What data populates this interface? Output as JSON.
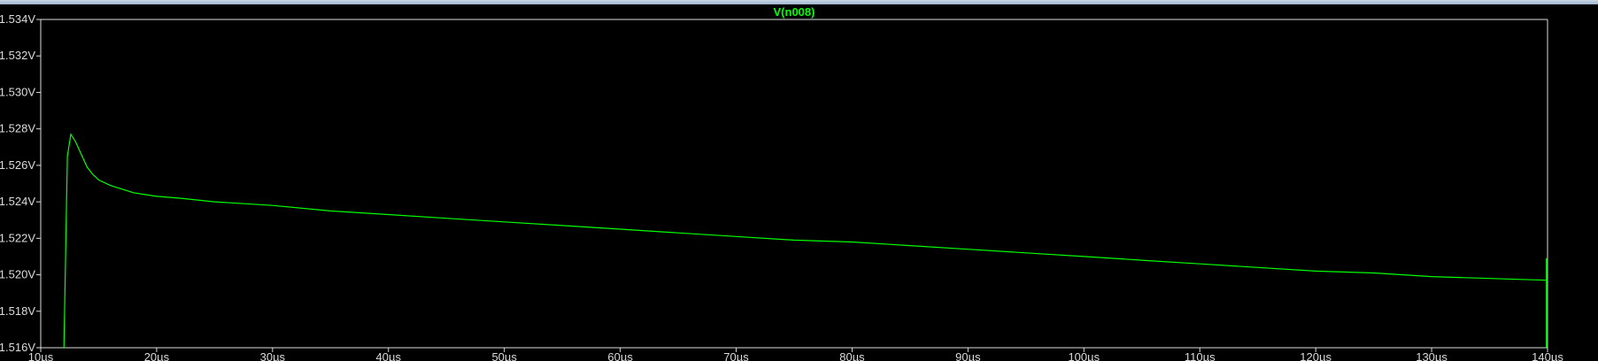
{
  "chart_data": {
    "type": "line",
    "title": "V(n008)",
    "xlabel": "",
    "ylabel": "",
    "x_ticks": [
      "10µs",
      "20µs",
      "30µs",
      "40µs",
      "50µs",
      "60µs",
      "70µs",
      "80µs",
      "90µs",
      "100µs",
      "110µs",
      "120µs",
      "130µs",
      "140µs"
    ],
    "y_ticks": [
      "1.534V",
      "1.532V",
      "1.530V",
      "1.528V",
      "1.526V",
      "1.524V",
      "1.522V",
      "1.520V",
      "1.518V",
      "1.516V"
    ],
    "xlim": [
      10,
      140
    ],
    "ylim": [
      1.516,
      1.534
    ],
    "grid": false,
    "series": [
      {
        "name": "V(n008)",
        "color": "#00ff00",
        "x": [
          12.0,
          12.3,
          12.6,
          13.0,
          13.5,
          14.0,
          14.5,
          15.0,
          16.0,
          17.0,
          18.0,
          19.0,
          20.0,
          22.0,
          25.0,
          30.0,
          35.0,
          40.0,
          45.0,
          50.0,
          55.0,
          60.0,
          65.0,
          70.0,
          75.0,
          80.0,
          85.0,
          90.0,
          95.0,
          100.0,
          105.0,
          110.0,
          115.0,
          120.0,
          125.0,
          130.0,
          135.0,
          139.9
        ],
        "y": [
          1.5127,
          1.5265,
          1.5277,
          1.5273,
          1.5266,
          1.5259,
          1.5255,
          1.5252,
          1.5249,
          1.5247,
          1.5245,
          1.5244,
          1.5243,
          1.5242,
          1.524,
          1.5238,
          1.5235,
          1.5233,
          1.5231,
          1.5229,
          1.5227,
          1.5225,
          1.5223,
          1.5221,
          1.5219,
          1.5218,
          1.5216,
          1.5214,
          1.5212,
          1.521,
          1.5208,
          1.5206,
          1.5204,
          1.5202,
          1.5201,
          1.5199,
          1.5198,
          1.5197
        ]
      }
    ],
    "end_spike": {
      "x": 139.9,
      "y_from": 1.5209,
      "y_to": 1.516
    }
  },
  "colors": {
    "background": "#000000",
    "axis": "#dcdcdc",
    "trace": "#00ff00",
    "title": "#00ff00"
  }
}
